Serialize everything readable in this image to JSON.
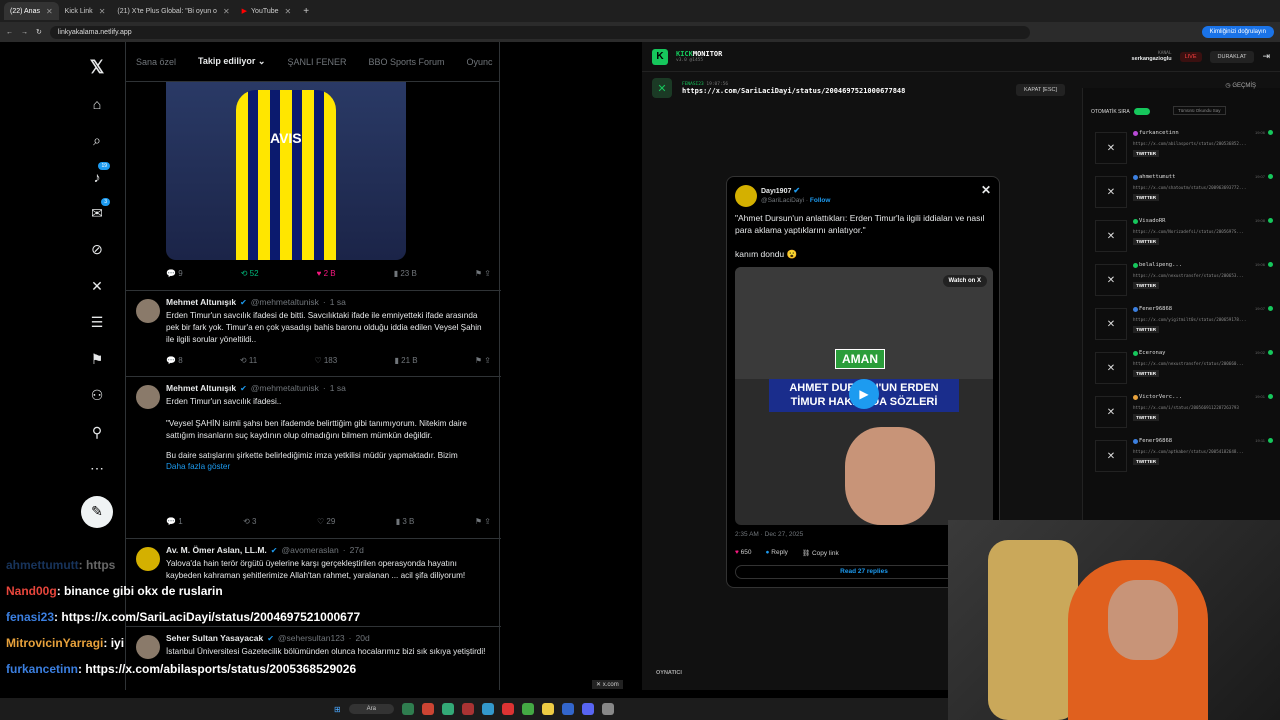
{
  "browser": {
    "tabs": [
      {
        "label": "(22) Anas",
        "active": true
      },
      {
        "label": "Kick Link",
        "active": false
      },
      {
        "label": "(21) X'te Plus Global: \"Bi oyun o",
        "active": false
      },
      {
        "label": "YouTube",
        "active": false
      }
    ],
    "url": "linkyakalama.netlify.app",
    "verify_label": "Kimliğinizi doğrulayın"
  },
  "x": {
    "tabs": [
      "Sana özel",
      "Takip ediliyor",
      "ŞANLI FENER",
      "BBO Sports Forum",
      "Oyunc"
    ],
    "badges": {
      "notifications": "19",
      "messages": "3"
    },
    "media_brand": "AVIS",
    "first_actions": {
      "reply": "9",
      "repost": "52",
      "like": "2 B",
      "views": "23 B"
    },
    "tweets": [
      {
        "name": "Mehmet Altunışık",
        "handle": "@mehmetaltunisk",
        "time": "1 sa",
        "text": "Erden Timur'un savcılık ifadesi de bitti. Savcılıktaki ifade ile emniyetteki ifade arasında pek bir fark yok. Timur'a en çok yasadışı bahis baronu olduğu iddia edilen Veysel Şahin ile ilgili sorular yöneltildi..",
        "reply": "8",
        "repost": "11",
        "like": "183",
        "views": "21 B"
      },
      {
        "name": "Mehmet Altunışık",
        "handle": "@mehmetaltunisk",
        "time": "1 sa",
        "text1": "Erden Timur'un savcılık ifadesi..",
        "text2": "\"Veysel ŞAHİN isimli şahsı ben ifademde belirttiğim gibi tanımıyorum. Nitekim daire sattığım insanların suç kaydının olup olmadığını bilmem mümkün değildir.",
        "text3": "Bu daire satışlarını şirkette belirlediğimiz imza yetkilisi müdür yapmaktadır. Bizim",
        "more": "Daha fazla göster",
        "reply": "1",
        "repost": "3",
        "like": "29",
        "views": "3 B"
      },
      {
        "name": "Av. M. Ömer Aslan, LL.M.",
        "handle": "@avomeraslan",
        "time": "27d",
        "text": "Yalova'da hain terör örgütü üyelerine karşı gerçekleştirilen operasyonda hayatını kaybeden kahraman şehitlerimize Allah'tan rahmet, yaralanan ... acil şifa diliyorum!"
      },
      {
        "name": "Seher Sultan Yasayacak",
        "handle": "@sehersultan123",
        "time": "20d",
        "text": "İstanbul Üniversitesi Gazetecilik bölümünden olunca hocalarımız bizi sık sıkıya yetiştirdi!"
      }
    ]
  },
  "chat": [
    {
      "user": "ahmettumutt",
      "msg": ": https"
    },
    {
      "user": "Nand00g",
      "msg": ": binance gibi okx de ruslarin"
    },
    {
      "user": "fenasi23",
      "msg": ": https://x.com/SariLaciDayi/status/2004697521000677"
    },
    {
      "user": "MitrovicinYarragi",
      "msg": ": iyi"
    },
    {
      "user": "furkancetinn",
      "msg": ": https://x.com/abilasports/status/2005368529026"
    }
  ],
  "kick": {
    "title": "MONITOR",
    "brand": "KICK",
    "version": "v3.0 @1455",
    "channel_label": "KANAL",
    "channel": "serkangazioglu",
    "live": "LIVE",
    "pause": "DURAKLAT",
    "current_user": "FENASI23",
    "current_time": "19:07:56",
    "current_url": "https://x.com/SariLaciDayi/status/2004697521000677848",
    "close_label": "KAPAT [ESC]",
    "history_label": "GEÇMİŞ",
    "auto_label": "OTOMATİK SIRA",
    "clear_label": "Tümünü Okundu Say",
    "player_label": "OYNATICI",
    "history": [
      {
        "name": "furkancetinn",
        "url": "https://x.com/abilasports/status/200536852...",
        "color": "#b84ad6",
        "time": "19:06"
      },
      {
        "name": "ahmettumutt",
        "url": "https://x.com/shatoutm/status/200963693772...",
        "color": "#3b7fe0",
        "time": "19:07"
      },
      {
        "name": "VisadoRR",
        "url": "https://x.com/Norizadefsi/status/2005697S...",
        "color": "#16c75c",
        "time": "19:08"
      },
      {
        "name": "belalipeng...",
        "url": "https://x.com/nexustransfer/status/200653...",
        "color": "#16c75c",
        "time": "19:06"
      },
      {
        "name": "Fener96868",
        "url": "https://x.com/yigitmilt0s/status/200659178...",
        "color": "#3b7fe0",
        "time": "19:07"
      },
      {
        "name": "Eceronay",
        "url": "https://x.com/nexustransfer/status/200660...",
        "color": "#16c75c",
        "time": "19:02"
      },
      {
        "name": "VictorVerc...",
        "url": "https://x.com/i/status/2005669112287263793",
        "color": "#e8a23c",
        "time": "19:01"
      },
      {
        "name": "Fener96868",
        "url": "https://x.com/aptkaber/status/20054182648...",
        "color": "#3b7fe0",
        "time": "19:11"
      }
    ],
    "tag": "TWITTER"
  },
  "embed": {
    "name": "Dayı1907",
    "handle": "@SariLaciDayi",
    "follow": "Follow",
    "quote": "\"Ahmet Dursun'un anlattıkları: Erden Timur'la ilgili iddiaları ve nasıl para aklama yaptıklarını anlatıyor.\"",
    "comment": "kanım dondu 😮",
    "watch": "Watch on X",
    "aman": "AMAN",
    "caption": "AHMET DURSUN'UN ERDEN TİMUR HAKKINDA SÖZLERİ",
    "date": "2:35 AM · Dec 27, 2025",
    "likes": "650",
    "reply": "Reply",
    "copy": "Copy link",
    "read": "Read 27 replies"
  },
  "taskbar": {
    "search": "Ara",
    "tab_label": "x.com"
  }
}
